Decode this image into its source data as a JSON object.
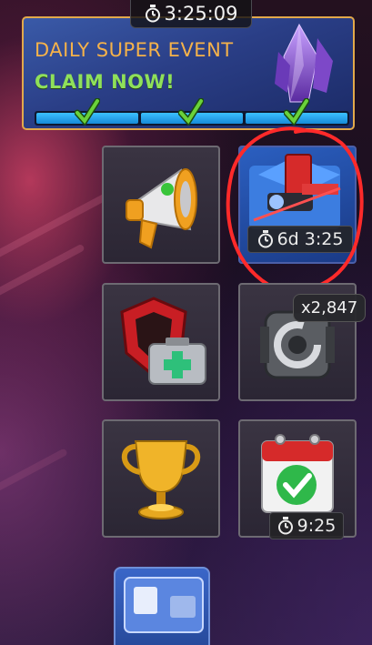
{
  "event": {
    "timer": "3:25:09",
    "title": "DAILY SUPER EVENT",
    "cta": "CLAIM NOW!",
    "progress_fraction": 1.0,
    "milestones_completed": 3,
    "icon": "crystal-icon"
  },
  "tiles": {
    "announcements": {
      "icon": "megaphone-icon"
    },
    "special_offer": {
      "icon": "offer-crate-icon",
      "timer": "6d 3:25"
    },
    "alliance_help": {
      "icon": "shield-medkit-icon"
    },
    "resource": {
      "icon": "gear-cube-icon",
      "count": "x2,847"
    },
    "trophy": {
      "icon": "trophy-icon"
    },
    "calendar": {
      "icon": "calendar-check-icon",
      "timer": "9:25"
    },
    "partial": {
      "icon": "card-icon"
    }
  },
  "colors": {
    "accent_gold": "#e2a94b",
    "cta_green": "#8fe05a",
    "progress_blue": "#1fa0ec",
    "annotation_red": "#ff2a2a"
  }
}
